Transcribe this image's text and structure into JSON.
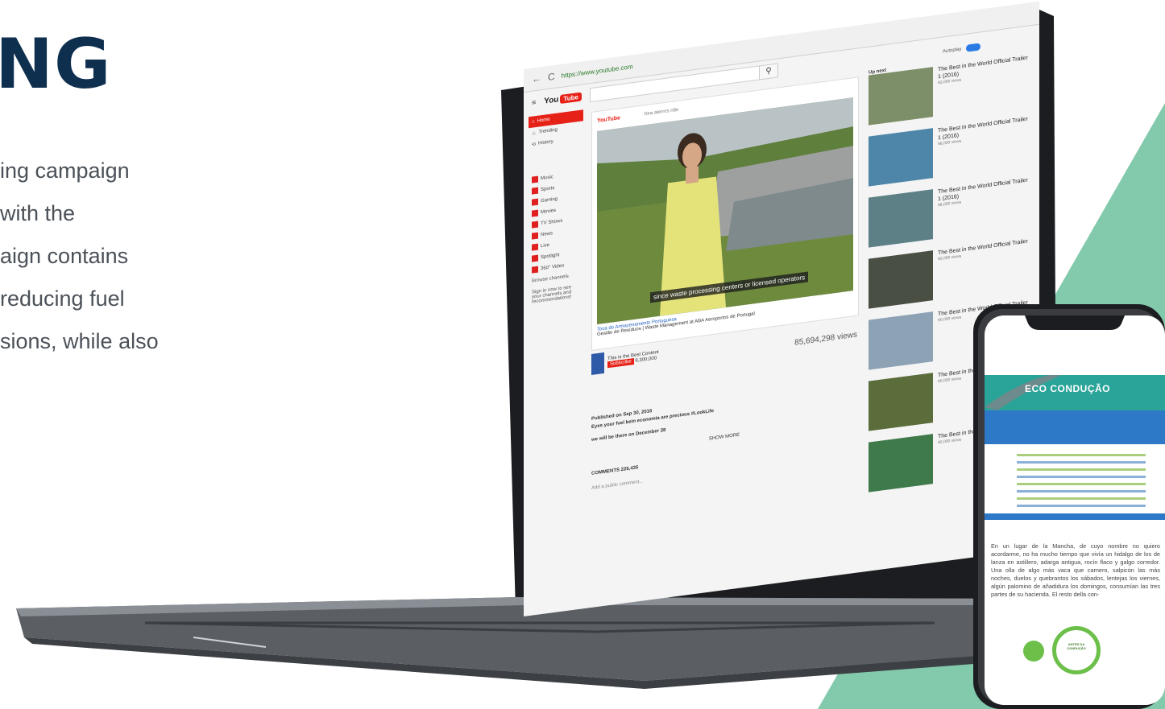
{
  "page": {
    "headline": "NG",
    "intro_lines": [
      "ing campaign",
      "with the",
      "aign contains",
      "reducing fuel",
      "sions, while also"
    ]
  },
  "laptop": {
    "browser": {
      "url": "https://www.youtube.com"
    },
    "youtube": {
      "logo": "You",
      "logo_play": "Tube",
      "sidebar_items": [
        "Home",
        "Trending",
        "History"
      ],
      "sidebar_subs": [
        "Music",
        "Sports",
        "Gaming",
        "Movies",
        "TV Shows",
        "News",
        "Live",
        "Spotlight",
        "360° Video"
      ],
      "browse_channels": "Browse channels",
      "signin_text": "Sign in now to see your channels and recommendations!",
      "player_search": "fora aterros não",
      "player_brand": "YouTube",
      "caption": "since waste processing centers or licensed operators",
      "video_channel_link": "Toca do Armazenamento Portuguesa",
      "video_title": "Gestão de Resíduos | Waste Management at ABA Aeroportos de Portugal",
      "channel_name": "This is the Best Content",
      "subscribe": "Subscribe",
      "subscribers": "8,300,000",
      "views": "85,694,298 views",
      "published": "Published on Sep 30, 2016",
      "desc1": "Eyes your fuel bein economia are precious #LookLife",
      "desc2": "we will be there on December 28",
      "show_more": "SHOW MORE",
      "comments": "COMMENTS  226,435",
      "comment_placeholder": "Add a public comment...",
      "up_next": "Up next",
      "autoplay": "Autoplay",
      "related": [
        {
          "title": "The Best in the World Official Trailer 1 (2016)",
          "meta": "93,000 views"
        },
        {
          "title": "The Best in the World Official Trailer 1 (2016)",
          "meta": "98,000 views"
        },
        {
          "title": "The Best in the World Official Trailer 1 (2016)",
          "meta": "98,000 views"
        },
        {
          "title": "The Best in the World Official Trailer",
          "meta": "90,000 views"
        },
        {
          "title": "The Best in the World Official Trailer",
          "meta": "90,000 views"
        },
        {
          "title": "The Best in the World Official Trailer",
          "meta": "90,000 views"
        },
        {
          "title": "The Best in the World Official Trailer",
          "meta": "90,000 views"
        }
      ]
    }
  },
  "phone": {
    "banner_title": "ECO CONDUÇÃO",
    "paragraph": "En un lugar de la Mancha, de cuyo nombre no quiero acordarme, no ha mucho tiempo que vivía un hidalgo de los de lanza en astillero, adarga antigua, rocín flaco y galgo corredor. Una olla de algo más vaca que carnero, salpicón las más noches, duelos y quebrantos los sábados, lentejas los viernes, algún palomino de añadidura los domingos, consumían las tres partes de su hacienda. El resto della con-",
    "badge": "ANTES DA CONDUÇÃO",
    "colors": {
      "teal": "#2aa398",
      "blue": "#2e78c8",
      "green": "#6cc04a",
      "navy": "#0f2f4f"
    }
  }
}
